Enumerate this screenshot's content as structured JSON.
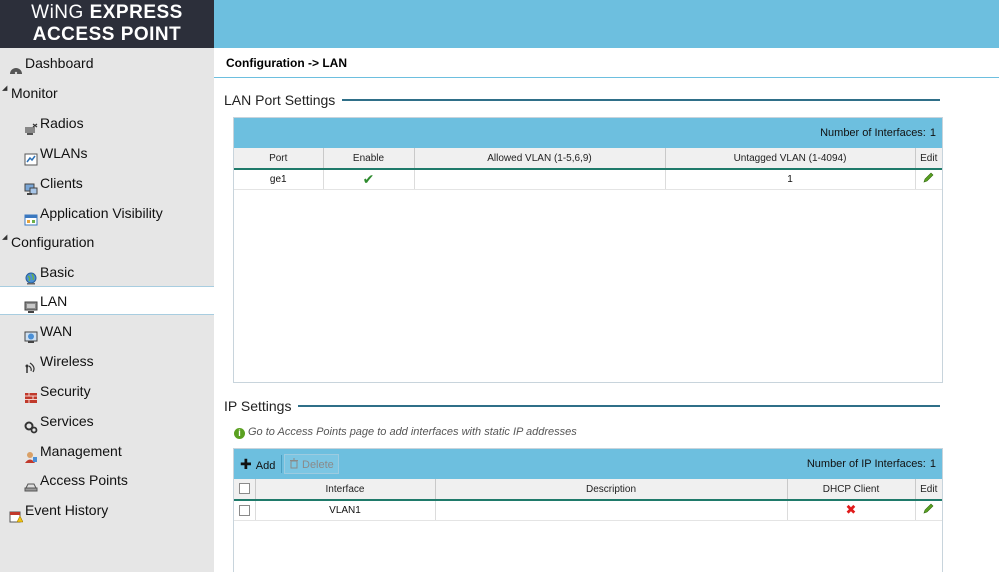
{
  "logo": {
    "line1_a": "WiNG ",
    "line1_b": "EXPRESS",
    "line2": "ACCESS POINT"
  },
  "breadcrumb": "Configuration -> LAN",
  "sidebar": {
    "items": [
      {
        "label": "Dashboard",
        "icon": "dashboard-icon",
        "level": 0
      },
      {
        "label": "Monitor",
        "icon": "expand-triangle",
        "level": 0,
        "group": true
      },
      {
        "label": "Radios",
        "icon": "radios-icon",
        "level": 1
      },
      {
        "label": "WLANs",
        "icon": "wlans-icon",
        "level": 1
      },
      {
        "label": "Clients",
        "icon": "clients-icon",
        "level": 1
      },
      {
        "label": "Application Visibility",
        "icon": "app-visibility-icon",
        "level": 1
      },
      {
        "label": "Configuration",
        "icon": "expand-triangle",
        "level": 0,
        "group": true
      },
      {
        "label": "Basic",
        "icon": "globe-icon",
        "level": 1
      },
      {
        "label": "LAN",
        "icon": "lan-icon",
        "level": 1,
        "selected": true
      },
      {
        "label": "WAN",
        "icon": "wan-icon",
        "level": 1
      },
      {
        "label": "Wireless",
        "icon": "wireless-icon",
        "level": 1
      },
      {
        "label": "Security",
        "icon": "firewall-icon",
        "level": 1
      },
      {
        "label": "Services",
        "icon": "gears-icon",
        "level": 1
      },
      {
        "label": "Management",
        "icon": "management-icon",
        "level": 1
      },
      {
        "label": "Access Points",
        "icon": "access-points-icon",
        "level": 1
      },
      {
        "label": "Event History",
        "icon": "event-history-icon",
        "level": 0
      }
    ]
  },
  "lan_port": {
    "title": "LAN Port Settings",
    "count_label": "Number of Interfaces:",
    "count": "1",
    "columns": [
      "Port",
      "Enable",
      "Allowed VLAN (1-5,6,9)",
      "Untagged VLAN (1-4094)",
      "Edit"
    ],
    "rows": [
      {
        "port": "ge1",
        "enabled": true,
        "allowed_vlan": "",
        "untagged_vlan": "1"
      }
    ]
  },
  "ip_settings": {
    "title": "IP Settings",
    "info": "Go to Access Points page to add interfaces with static IP addresses",
    "add_label": "Add",
    "delete_label": "Delete",
    "count_label": "Number of IP Interfaces:",
    "count": "1",
    "columns": [
      "",
      "Interface",
      "Description",
      "DHCP Client",
      "Edit"
    ],
    "rows": [
      {
        "interface": "VLAN1",
        "description": "",
        "dhcp_client": false
      }
    ]
  },
  "colors": {
    "banner": "#6dbfdf",
    "sidebar": "#e6e6e6",
    "logo_bg": "#2c2f3a",
    "accent_rule": "#1f7a6a"
  }
}
